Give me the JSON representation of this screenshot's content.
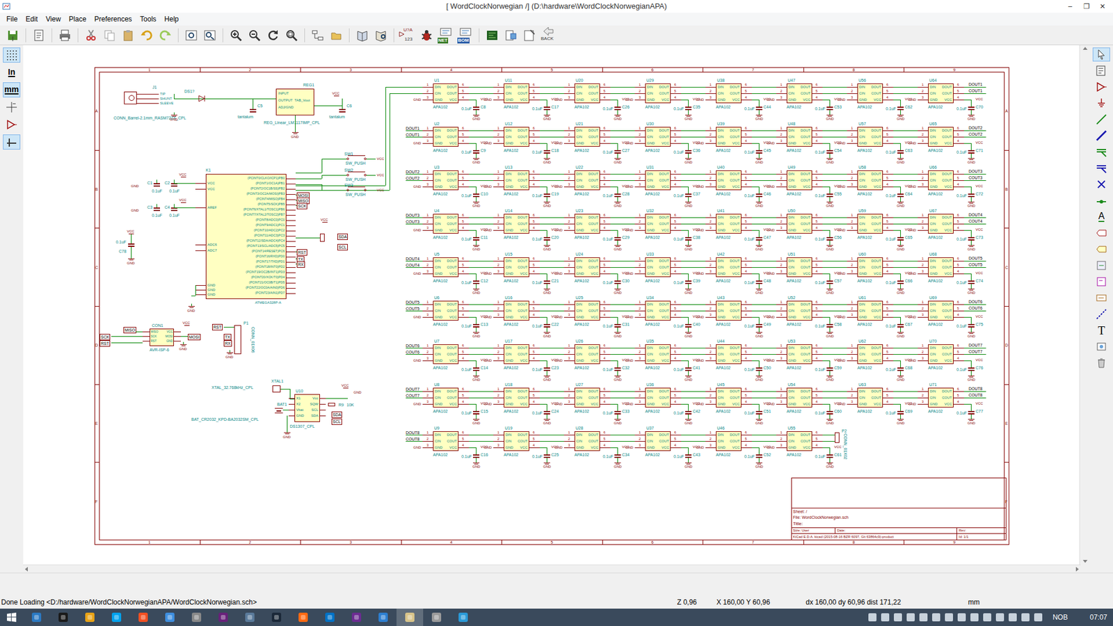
{
  "window": {
    "title": "[ WordClockNorwegian /] (D:\\hardware\\WordClockNorwegianAPA)",
    "controls": [
      "–",
      "❐",
      "✕"
    ]
  },
  "menu": [
    "File",
    "Edit",
    "View",
    "Place",
    "Preferences",
    "Tools",
    "Help"
  ],
  "toolbar": {
    "annotate_top": "U?A",
    "annotate_bottom": "123",
    "net": "NET",
    "bom": "BOM",
    "back": "BACK"
  },
  "left_toolbar": {
    "grid_selected": true,
    "units": [
      {
        "label": "In",
        "selected": false
      },
      {
        "label": "mm",
        "selected": true
      }
    ],
    "cursor_selected": false,
    "hidden_pins_selected": false,
    "free_angle_selected": true
  },
  "right_toolbar": {
    "select_selected": true,
    "label_text": "A",
    "text_text": "T"
  },
  "schematic": {
    "border": {
      "cols": [
        "1",
        "2",
        "3",
        "4",
        "5",
        "6",
        "7",
        "8",
        "9"
      ],
      "rows": [
        "A",
        "B",
        "C",
        "D",
        "E",
        "F"
      ]
    },
    "power": {
      "vcc": "VCC",
      "gnd": "GND"
    },
    "led_part": {
      "value": "APA102",
      "cap_value": "0.1uF",
      "pins_left": [
        {
          "name": "DIN",
          "num": "1"
        },
        {
          "name": "CIN",
          "num": "2"
        },
        {
          "name": "GND",
          "num": "3"
        }
      ],
      "pins_right": [
        {
          "name": "DOUT",
          "num": "6"
        },
        {
          "name": "COUT",
          "num": "5"
        },
        {
          "name": "VCC",
          "num": "4"
        }
      ]
    },
    "led_rows": [
      {
        "in": [],
        "out": [
          "DOUT1",
          "COUT1"
        ],
        "chips": [
          {
            "ref": "U1",
            "cap": "C8"
          },
          {
            "ref": "U11",
            "cap": "C17"
          },
          {
            "ref": "U20",
            "cap": "C26"
          },
          {
            "ref": "U29",
            "cap": "C35"
          },
          {
            "ref": "U38",
            "cap": "C44"
          },
          {
            "ref": "U47",
            "cap": "C53"
          },
          {
            "ref": "U56",
            "cap": "C62"
          },
          {
            "ref": "U64",
            "cap": "C70"
          }
        ]
      },
      {
        "in": [
          "DOUT1",
          "COUT1"
        ],
        "out": [
          "DOUT2",
          "COUT2"
        ],
        "chips": [
          {
            "ref": "U2",
            "cap": "C9"
          },
          {
            "ref": "U12",
            "cap": "C18"
          },
          {
            "ref": "U21",
            "cap": "C27"
          },
          {
            "ref": "U30",
            "cap": "C36"
          },
          {
            "ref": "U39",
            "cap": "C45"
          },
          {
            "ref": "U48",
            "cap": "C54"
          },
          {
            "ref": "U57",
            "cap": "C63"
          },
          {
            "ref": "U65",
            "cap": "C71"
          }
        ]
      },
      {
        "in": [
          "DOUT2",
          "COUT2"
        ],
        "out": [
          "DOUT3",
          "COUT3"
        ],
        "chips": [
          {
            "ref": "U3",
            "cap": "C10"
          },
          {
            "ref": "U13",
            "cap": "C19"
          },
          {
            "ref": "U22",
            "cap": "C28"
          },
          {
            "ref": "U31",
            "cap": "C37"
          },
          {
            "ref": "U40",
            "cap": "C46"
          },
          {
            "ref": "U49",
            "cap": "C55"
          },
          {
            "ref": "U58",
            "cap": "C64"
          },
          {
            "ref": "U66",
            "cap": "C72"
          }
        ]
      },
      {
        "in": [
          "DOUT3",
          "COUT3"
        ],
        "out": [
          "DOUT4",
          "COUT4"
        ],
        "chips": [
          {
            "ref": "U4",
            "cap": "C11"
          },
          {
            "ref": "U14",
            "cap": "C20"
          },
          {
            "ref": "U23",
            "cap": "C29"
          },
          {
            "ref": "U32",
            "cap": "C38"
          },
          {
            "ref": "U41",
            "cap": "C47"
          },
          {
            "ref": "U50",
            "cap": "C56"
          },
          {
            "ref": "U59",
            "cap": "C65"
          },
          {
            "ref": "U67",
            "cap": "C73"
          }
        ]
      },
      {
        "in": [
          "DOUT4",
          "COUT4"
        ],
        "out": [
          "DOUT5",
          "COUT5"
        ],
        "chips": [
          {
            "ref": "U5",
            "cap": "C12"
          },
          {
            "ref": "U15",
            "cap": "C21"
          },
          {
            "ref": "U24",
            "cap": "C30"
          },
          {
            "ref": "U33",
            "cap": "C39"
          },
          {
            "ref": "U42",
            "cap": "C48"
          },
          {
            "ref": "U51",
            "cap": "C57"
          },
          {
            "ref": "U60",
            "cap": "C66"
          },
          {
            "ref": "U68",
            "cap": "C74"
          }
        ]
      },
      {
        "in": [
          "DOUT5",
          "COUT5"
        ],
        "out": [
          "DOUT6",
          "COUT6"
        ],
        "chips": [
          {
            "ref": "U6",
            "cap": "C13"
          },
          {
            "ref": "U16",
            "cap": "C22"
          },
          {
            "ref": "U25",
            "cap": "C31"
          },
          {
            "ref": "U34",
            "cap": "C40"
          },
          {
            "ref": "U43",
            "cap": "C49"
          },
          {
            "ref": "U52",
            "cap": "C58"
          },
          {
            "ref": "U61",
            "cap": "C67"
          },
          {
            "ref": "U69",
            "cap": "C75"
          }
        ]
      },
      {
        "in": [
          "DOUT6",
          "COUT6"
        ],
        "out": [
          "DOUT7",
          "COUT7"
        ],
        "chips": [
          {
            "ref": "U7",
            "cap": "C14"
          },
          {
            "ref": "U17",
            "cap": "C23"
          },
          {
            "ref": "U26",
            "cap": "C32"
          },
          {
            "ref": "U35",
            "cap": "C41"
          },
          {
            "ref": "U44",
            "cap": "C50"
          },
          {
            "ref": "U53",
            "cap": "C59"
          },
          {
            "ref": "U62",
            "cap": "C68"
          },
          {
            "ref": "U70",
            "cap": "C76"
          }
        ]
      },
      {
        "in": [
          "DOUT7",
          "COUT7"
        ],
        "out": [
          "DOUT8",
          "COUT8"
        ],
        "chips": [
          {
            "ref": "U8",
            "cap": "C15"
          },
          {
            "ref": "U18",
            "cap": "C24"
          },
          {
            "ref": "U27",
            "cap": "C33"
          },
          {
            "ref": "U36",
            "cap": "C42"
          },
          {
            "ref": "U45",
            "cap": "C51"
          },
          {
            "ref": "U54",
            "cap": "C60"
          },
          {
            "ref": "U63",
            "cap": "C69"
          },
          {
            "ref": "U71",
            "cap": "C77"
          }
        ]
      },
      {
        "in": [
          "DOUT8",
          "COUT8"
        ],
        "out": [],
        "chips": [
          {
            "ref": "U9",
            "cap": "C16"
          },
          {
            "ref": "U19",
            "cap": "C25"
          },
          {
            "ref": "U28",
            "cap": "C34"
          },
          {
            "ref": "U37",
            "cap": "C43"
          },
          {
            "ref": "U46",
            "cap": "C52"
          },
          {
            "ref": "U55",
            "cap": "C61"
          }
        ]
      }
    ],
    "end_connector": {
      "ref": "P2",
      "value": "CONN_01X02"
    },
    "j1": {
      "ref": "J1",
      "value": "CONN_Barrel-2.1mm_RASM722X_CPL",
      "pins": [
        "TIP",
        "SHUNT",
        "SLEEVE"
      ]
    },
    "diode": {
      "ref": "DS1?"
    },
    "regulator": {
      "ref": "REG1",
      "value": "REG_Linear_LM1117IMP_CPL",
      "pins": [
        "INPUT",
        "OUTPUT",
        "ADJ/GND"
      ],
      "tab": "TAB_Vout",
      "caps": [
        {
          "ref": "C5",
          "value": "tantalum"
        },
        {
          "ref": "C6",
          "value": "tantalum"
        }
      ]
    },
    "mcu": {
      "ref": "K1",
      "value": "ATMEGA328P-A",
      "left_pins": [
        "VCC",
        "VCC",
        "AREF",
        "ADC6",
        "ADC7",
        "GND",
        "GND",
        "GND"
      ],
      "right_pins": [
        "(PCINT0/CLKO/ICP1)PB0",
        "(PCINT1/OC1A)PB1",
        "(PCINT2/OC1B/SS)PB2",
        "(PCINT3/OC2A/MOSI)PB3",
        "(PCINT4/MISO)PB4",
        "(PCINT5/SCK)PB5",
        "(PCINT6/XTAL1/TOSC1)PB6",
        "(PCINT7/XTAL2/TOSC2)PB7",
        "(PCINT8/ADC0)PC0",
        "(PCINT9/ADC1)PC1",
        "(PCINT10/ADC2)PC2",
        "(PCINT11/ADC3)PC3",
        "(PCINT12/SDA/ADC4)PC4",
        "(PCINT13/SCL/ADC5)PC5",
        "(PCINT14/RESET)PC6",
        "(PCINT16/RXD)PD0",
        "(PCINT17/TXD)PD1",
        "(PCINT18/INT0)PD2",
        "(PCINT19/OC2B/INT1)PD3",
        "(PCINT20/XCK/T0)PD4",
        "(PCINT21/OC0B/T1)PD5",
        "(PCINT22/OC0A/AIN0)PD6",
        "(PCINT23/AIN1)PD7"
      ],
      "caps": [
        {
          "ref": "C1",
          "value": "0.1uF"
        },
        {
          "ref": "C2",
          "value": "0.1uF"
        },
        {
          "ref": "C3",
          "value": "0.1uF"
        },
        {
          "ref": "C4",
          "value": "0.1uF"
        }
      ],
      "bulk_cap": {
        "ref": "C78",
        "value": "0.1uF"
      },
      "labels": [
        "MOSI",
        "MISO",
        "SCK",
        "RST",
        "TX",
        "RX"
      ],
      "i2c_labels": [
        "SDA",
        "SCL"
      ]
    },
    "switches": [
      {
        "ref": "SW1",
        "value": "SW_PUSH"
      },
      {
        "ref": "SW2",
        "value": "SW_PUSH"
      },
      {
        "ref": "SW3",
        "value": "SW_PUSH"
      }
    ],
    "isp": {
      "ref": "CON1",
      "value": "AVR-ISP-6",
      "left": [
        "MISO",
        "SCK",
        "RST"
      ],
      "right": [
        "VCC",
        "MOSI",
        "GND"
      ],
      "ext_left": [
        "SCK",
        "RST"
      ],
      "ext_top": "MISO",
      "ext_right": "MOSI"
    },
    "p1": {
      "ref": "P1",
      "value": "CONN_01X06",
      "label": "RST",
      "pins": [
        "TX",
        "RX"
      ]
    },
    "xtal": {
      "ref": "XTAL1",
      "value": "XTAL_32.768kHz_CPL"
    },
    "rtc": {
      "ref": "U10",
      "value": "DS1307_CPL",
      "left": [
        "X1",
        "X2",
        "Vbat",
        "GND"
      ],
      "right": [
        "Vcc",
        "SQW",
        "SCL",
        "SDA"
      ],
      "labels": [
        "SDA",
        "SCL"
      ]
    },
    "battery": {
      "ref": "BAT1",
      "value": "BAT_CR2032_KPD-BA2032SM_CPL"
    },
    "resistor": {
      "ref": "R9",
      "value": "10K"
    },
    "title_block": {
      "sheet": "Sheet: /",
      "file": "File: WordClockNorwegian.sch",
      "title": "Title:",
      "size": "Size: User",
      "date": "Date:",
      "rev": "Rev:",
      "kicad": "KiCad E.D.A.  kicad (2015-08-16 BZR 6097, Git 63864c9)-product",
      "id": "Id: 1/1"
    }
  },
  "status_bar": {
    "message": "Done Loading <D:/hardware/WordClockNorwegianAPA/WordClockNorwegian.sch>",
    "zoom": "Z 0,96",
    "position": "X 160,00  Y 60,96",
    "delta": "dx 160,00  dy 60,96  dist 171,22",
    "units": "mm"
  },
  "taskbar": {
    "language": "NOB",
    "time": "07:07"
  }
}
